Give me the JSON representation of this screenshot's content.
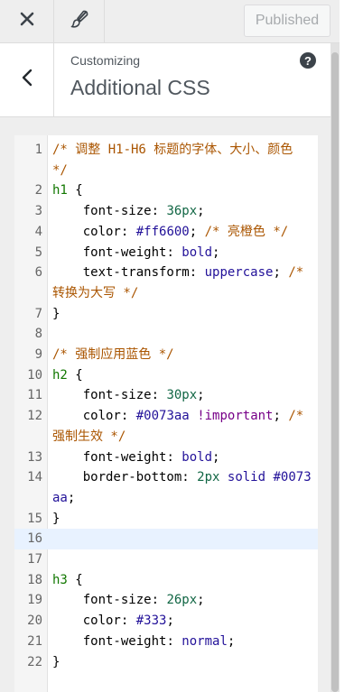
{
  "header": {
    "close_icon": "close-icon",
    "brush_icon": "brush-icon",
    "publish_label": "Published"
  },
  "section": {
    "breadcrumb": "Customizing",
    "title": "Additional CSS",
    "help_icon": "?"
  },
  "colors": {
    "panel_bg": "#eeeeee",
    "comment": "#aa5500",
    "selector": "#117700",
    "number": "#116644",
    "atom": "#221199",
    "keyword": "#770088",
    "active_line": "#e8f2ff"
  },
  "editor": {
    "active_line": 16,
    "lines": [
      {
        "n": "1",
        "tokens": [
          [
            "c-comment",
            "/* 调整 H1-H6 标题的字体、大小、颜色 */"
          ]
        ]
      },
      {
        "n": "2",
        "tokens": [
          [
            "c-sel",
            "h1"
          ],
          [
            "",
            " {"
          ]
        ]
      },
      {
        "n": "3",
        "tokens": [
          [
            "",
            "    "
          ],
          [
            "c-prop",
            "font-size"
          ],
          [
            "",
            ": "
          ],
          [
            "c-num",
            "36px"
          ],
          [
            "",
            ";"
          ]
        ]
      },
      {
        "n": "4",
        "tokens": [
          [
            "",
            "    "
          ],
          [
            "c-prop",
            "color"
          ],
          [
            "",
            ": "
          ],
          [
            "c-atom",
            "#ff6600"
          ],
          [
            "",
            "; "
          ],
          [
            "c-comment",
            "/* 亮橙色 */"
          ]
        ]
      },
      {
        "n": "5",
        "tokens": [
          [
            "",
            "    "
          ],
          [
            "c-prop",
            "font-weight"
          ],
          [
            "",
            ": "
          ],
          [
            "c-atom",
            "bold"
          ],
          [
            "",
            ";"
          ]
        ]
      },
      {
        "n": "6",
        "tokens": [
          [
            "",
            "    "
          ],
          [
            "c-prop",
            "text-transform"
          ],
          [
            "",
            ": "
          ],
          [
            "c-atom",
            "uppercase"
          ],
          [
            "",
            "; "
          ],
          [
            "c-comment",
            "/* 转换为大写 */"
          ]
        ]
      },
      {
        "n": "7",
        "tokens": [
          [
            "",
            "}"
          ]
        ]
      },
      {
        "n": "8",
        "tokens": []
      },
      {
        "n": "9",
        "tokens": [
          [
            "c-comment",
            "/* 强制应用蓝色 */"
          ]
        ]
      },
      {
        "n": "10",
        "tokens": [
          [
            "c-sel",
            "h2"
          ],
          [
            "",
            " {"
          ]
        ]
      },
      {
        "n": "11",
        "tokens": [
          [
            "",
            "    "
          ],
          [
            "c-prop",
            "font-size"
          ],
          [
            "",
            ": "
          ],
          [
            "c-num",
            "30px"
          ],
          [
            "",
            ";"
          ]
        ]
      },
      {
        "n": "12",
        "tokens": [
          [
            "",
            "    "
          ],
          [
            "c-prop",
            "color"
          ],
          [
            "",
            ": "
          ],
          [
            "c-atom",
            "#0073aa"
          ],
          [
            "",
            " "
          ],
          [
            "c-kw",
            "!important"
          ],
          [
            "",
            "; "
          ],
          [
            "c-comment",
            "/* 强制生效 */"
          ]
        ]
      },
      {
        "n": "13",
        "tokens": [
          [
            "",
            "    "
          ],
          [
            "c-prop",
            "font-weight"
          ],
          [
            "",
            ": "
          ],
          [
            "c-atom",
            "bold"
          ],
          [
            "",
            ";"
          ]
        ]
      },
      {
        "n": "14",
        "tokens": [
          [
            "",
            "    "
          ],
          [
            "c-prop",
            "border-bottom"
          ],
          [
            "",
            ": "
          ],
          [
            "c-num",
            "2px"
          ],
          [
            "",
            " "
          ],
          [
            "c-atom",
            "solid"
          ],
          [
            "",
            " "
          ],
          [
            "c-atom",
            "#0073aa"
          ],
          [
            "",
            ";"
          ]
        ]
      },
      {
        "n": "15",
        "tokens": [
          [
            "",
            "}"
          ]
        ]
      },
      {
        "n": "16",
        "tokens": []
      },
      {
        "n": "17",
        "tokens": []
      },
      {
        "n": "18",
        "tokens": [
          [
            "c-sel",
            "h3"
          ],
          [
            "",
            " {"
          ]
        ]
      },
      {
        "n": "19",
        "tokens": [
          [
            "",
            "    "
          ],
          [
            "c-prop",
            "font-size"
          ],
          [
            "",
            ": "
          ],
          [
            "c-num",
            "26px"
          ],
          [
            "",
            ";"
          ]
        ]
      },
      {
        "n": "20",
        "tokens": [
          [
            "",
            "    "
          ],
          [
            "c-prop",
            "color"
          ],
          [
            "",
            ": "
          ],
          [
            "c-atom",
            "#333"
          ],
          [
            "",
            ";"
          ]
        ]
      },
      {
        "n": "21",
        "tokens": [
          [
            "",
            "    "
          ],
          [
            "c-prop",
            "font-weight"
          ],
          [
            "",
            ": "
          ],
          [
            "c-atom",
            "normal"
          ],
          [
            "",
            ";"
          ]
        ]
      },
      {
        "n": "22",
        "tokens": [
          [
            "",
            "}"
          ]
        ]
      }
    ]
  }
}
